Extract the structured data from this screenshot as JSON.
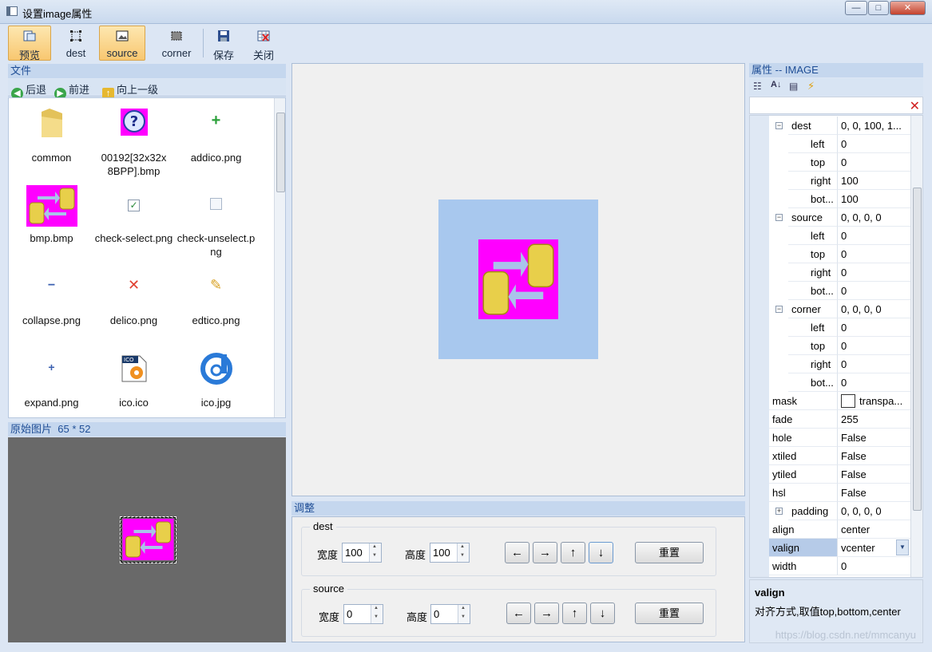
{
  "window": {
    "title": "设置image属性",
    "min": "—",
    "max": "□",
    "close": "✕"
  },
  "toolbar": {
    "items": [
      {
        "label": "预览",
        "icon": "preview-icon"
      },
      {
        "label": "dest",
        "icon": "dest-icon"
      },
      {
        "label": "source",
        "icon": "source-icon"
      },
      {
        "label": "corner",
        "icon": "corner-icon"
      },
      {
        "label": "保存",
        "icon": "save-icon"
      },
      {
        "label": "关闭",
        "icon": "close-grid-icon"
      }
    ]
  },
  "files": {
    "header": "文件",
    "nav": {
      "back": "后退",
      "forward": "前进",
      "up": "向上一级"
    },
    "items": [
      {
        "name": "common",
        "icon": "folder-icon"
      },
      {
        "name": "00192[32x32x8BPP].bmp",
        "icon": "help-icon"
      },
      {
        "name": "addico.png",
        "icon": "plus-icon"
      },
      {
        "name": "bmp.bmp",
        "icon": "transfer-image-icon"
      },
      {
        "name": "check-select.png",
        "icon": "checkbox-checked-icon"
      },
      {
        "name": "check-unselect.png",
        "icon": "checkbox-empty-icon"
      },
      {
        "name": "collapse.png",
        "icon": "minus-icon"
      },
      {
        "name": "delico.png",
        "icon": "delete-icon"
      },
      {
        "name": "edtico.png",
        "icon": "pencil-icon"
      },
      {
        "name": "expand.png",
        "icon": "plus-small-icon"
      },
      {
        "name": "ico.ico",
        "icon": "ico-file-icon"
      },
      {
        "name": "ico.jpg",
        "icon": "d-logo-icon"
      }
    ]
  },
  "original": {
    "label": "原始图片",
    "size": "65 * 52"
  },
  "adjust": {
    "header": "调整",
    "dest": {
      "title": "dest",
      "width_label": "宽度",
      "width": "100",
      "height_label": "高度",
      "height": "100",
      "reset": "重置"
    },
    "source": {
      "title": "source",
      "width_label": "宽度",
      "width": "0",
      "height_label": "高度",
      "height": "0",
      "reset": "重置"
    },
    "arrows": {
      "left": "←",
      "right": "→",
      "up": "↑",
      "down": "↓"
    }
  },
  "properties": {
    "header": "属性 -- IMAGE",
    "rows": [
      {
        "name": "dest",
        "value": "0, 0, 100, 1...",
        "level": 1,
        "expander": "⊟"
      },
      {
        "name": "left",
        "value": "0",
        "level": 2
      },
      {
        "name": "top",
        "value": "0",
        "level": 2
      },
      {
        "name": "right",
        "value": "100",
        "level": 2
      },
      {
        "name": "bot...",
        "value": "100",
        "level": 2
      },
      {
        "name": "source",
        "value": "0, 0, 0, 0",
        "level": 1,
        "expander": "⊟"
      },
      {
        "name": "left",
        "value": "0",
        "level": 2
      },
      {
        "name": "top",
        "value": "0",
        "level": 2
      },
      {
        "name": "right",
        "value": "0",
        "level": 2
      },
      {
        "name": "bot...",
        "value": "0",
        "level": 2
      },
      {
        "name": "corner",
        "value": "0, 0, 0, 0",
        "level": 1,
        "expander": "⊟"
      },
      {
        "name": "left",
        "value": "0",
        "level": 2
      },
      {
        "name": "top",
        "value": "0",
        "level": 2
      },
      {
        "name": "right",
        "value": "0",
        "level": 2
      },
      {
        "name": "bot...",
        "value": "0",
        "level": 2
      },
      {
        "name": "mask",
        "value": "transpa...",
        "level": 0,
        "swatch": true
      },
      {
        "name": "fade",
        "value": "255",
        "level": 0
      },
      {
        "name": "hole",
        "value": "False",
        "level": 0
      },
      {
        "name": "xtiled",
        "value": "False",
        "level": 0
      },
      {
        "name": "ytiled",
        "value": "False",
        "level": 0
      },
      {
        "name": "hsl",
        "value": "False",
        "level": 0
      },
      {
        "name": "padding",
        "value": "0, 0, 0, 0",
        "level": 1,
        "expander": "⊞"
      },
      {
        "name": "align",
        "value": "center",
        "level": 0
      },
      {
        "name": "valign",
        "value": "vcenter",
        "level": 0,
        "selected": true
      },
      {
        "name": "width",
        "value": "0",
        "level": 0
      }
    ],
    "description": {
      "title": "valign",
      "text": "对齐方式,取值top,bottom,center"
    },
    "watermark": "https://blog.csdn.net/mmcanyu"
  },
  "colors": {
    "accent_bg": "#c5d7ee",
    "accent_text": "#1f4e96",
    "magenta": "#ff00ff",
    "preview_frame": "#a8c8ee"
  }
}
